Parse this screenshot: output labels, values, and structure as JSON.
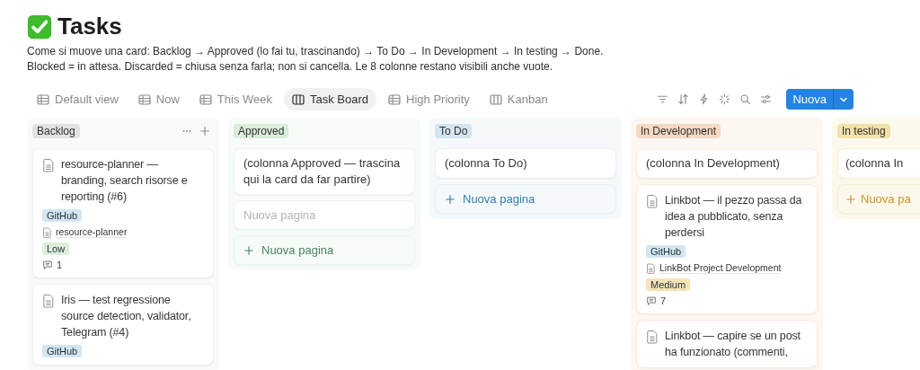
{
  "page": {
    "title": "Tasks",
    "description": [
      "Come si muove una card: Backlog → Approved (lo fai tu, trascinando) → To Do → In Development → In testing → Done.",
      "Blocked = in attesa. Discarded = chiusa senza farla; non si cancella. Le 8 colonne restano visibili anche vuote."
    ]
  },
  "views": [
    {
      "label": "Default view",
      "kind": "table",
      "selected": false
    },
    {
      "label": "Now",
      "kind": "table",
      "selected": false
    },
    {
      "label": "This Week",
      "kind": "table",
      "selected": false
    },
    {
      "label": "Task Board",
      "kind": "board",
      "selected": true
    },
    {
      "label": "High Priority",
      "kind": "table",
      "selected": false
    },
    {
      "label": "Kanban",
      "kind": "board",
      "selected": false
    }
  ],
  "toolbar": {
    "new_button": "Nuova"
  },
  "columns": [
    {
      "name": "Backlog",
      "color": "#e3e2e0",
      "header_actions": true,
      "items": [
        {
          "kind": "task",
          "title": "resource-planner — branding, search risorse e reporting (#6)",
          "tags": [
            {
              "label": "GitHub",
              "color": "#d3e5ef"
            }
          ],
          "relation": "resource-planner",
          "priority": {
            "label": "Low",
            "color": "#dbeddb"
          },
          "comments": "1"
        },
        {
          "kind": "task",
          "title": "Iris — test regressione source detection, validator, Telegram (#4)",
          "tags": [
            {
              "label": "GitHub",
              "color": "#d3e5ef"
            }
          ]
        }
      ]
    },
    {
      "name": "Approved",
      "color": "#dbeddb",
      "header_actions": false,
      "items": [
        {
          "kind": "note",
          "text": "(colonna Approved — trascina qui la card da far partire)"
        },
        {
          "kind": "draft",
          "placeholder": "Nuova pagina"
        }
      ],
      "add": {
        "label": "Nuova pagina",
        "color": "#448361"
      }
    },
    {
      "name": "To Do",
      "color": "#d3e5ef",
      "header_actions": false,
      "items": [
        {
          "kind": "note",
          "text": "(colonna To Do)"
        }
      ],
      "add": {
        "label": "Nuova pagina",
        "color": "#337ea9"
      }
    },
    {
      "name": "In Development",
      "color": "#f5d9c4",
      "header_actions": false,
      "items": [
        {
          "kind": "note",
          "text": "(colonna In Development)"
        },
        {
          "kind": "task",
          "title": "Linkbot — il pezzo passa da idea a pubblicato, senza perdersi",
          "tags": [
            {
              "label": "GitHub",
              "color": "#d3e5ef"
            }
          ],
          "relation": "LinkBot Project Development",
          "priority": {
            "label": "Medium",
            "color": "#f6e3b6"
          },
          "comments": "7"
        },
        {
          "kind": "task",
          "title": "Linkbot — capire se un post ha funzionato (commenti,"
        }
      ]
    },
    {
      "name": "In testing",
      "color": "#f1e2a8",
      "header_actions": false,
      "items": [
        {
          "kind": "note",
          "text": "(colonna In"
        }
      ],
      "add": {
        "label": "Nuova pa",
        "color": "#cb912f"
      }
    }
  ]
}
